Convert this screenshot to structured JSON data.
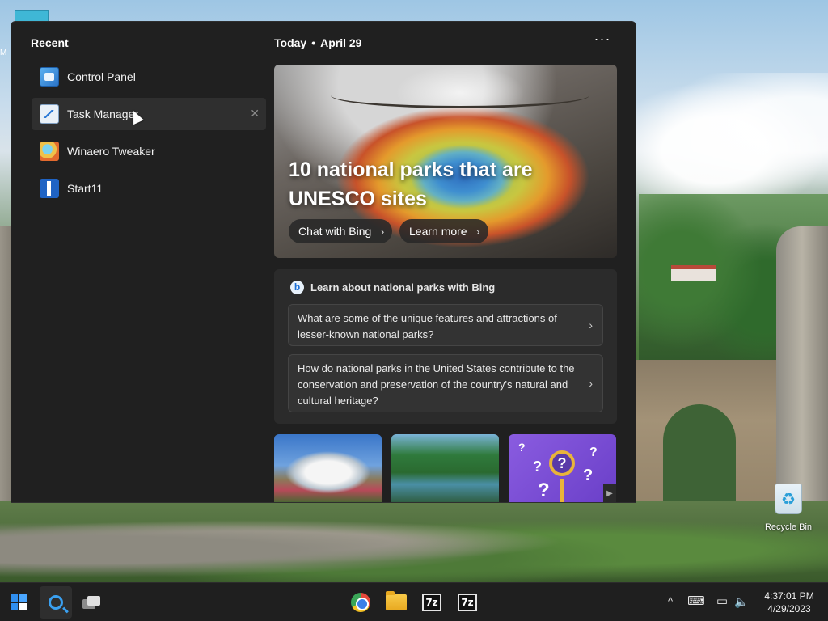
{
  "desktop": {
    "recycle_bin_label": "Recycle Bin",
    "top_icon_label": "M"
  },
  "recent": {
    "title": "Recent",
    "items": [
      {
        "label": "Control Panel",
        "icon": "control-panel-icon"
      },
      {
        "label": "Task Manager",
        "icon": "task-manager-icon"
      },
      {
        "label": "Winaero Tweaker",
        "icon": "winaero-tweaker-icon"
      },
      {
        "label": "Start11",
        "icon": "start11-icon"
      }
    ],
    "remove_glyph": "✕"
  },
  "today": {
    "label": "Today",
    "separator": "•",
    "date": "April 29",
    "more_glyph": "···"
  },
  "hero": {
    "title": "10 national parks that are UNESCO sites",
    "chat_button": "Chat with Bing",
    "learn_button": "Learn more",
    "chevron": "›"
  },
  "bing": {
    "logo": "b",
    "title": "Learn about national parks with Bing",
    "questions": [
      "What are some of the unique features and attractions of lesser-known national parks?",
      "How do national parks in the United States contribute to the conservation and preservation of the country's natural and cultural heritage?"
    ],
    "chevron": "›"
  },
  "thumbnails": [
    {
      "name": "mountain-meadow-thumbnail"
    },
    {
      "name": "forest-lake-thumbnail"
    },
    {
      "name": "quiz-thumbnail"
    }
  ],
  "taskbar": {
    "apps": [
      {
        "name": "start-button",
        "icon": "windows-logo-icon"
      },
      {
        "name": "search-button",
        "icon": "search-icon"
      },
      {
        "name": "task-view-button",
        "icon": "task-view-icon"
      },
      {
        "name": "chrome-button",
        "icon": "chrome-icon"
      },
      {
        "name": "file-explorer-button",
        "icon": "folder-icon"
      },
      {
        "name": "7zip-button-1",
        "icon": "7zip-icon",
        "text": "7z"
      },
      {
        "name": "7zip-button-2",
        "icon": "7zip-icon",
        "text": "7z"
      }
    ],
    "tray": {
      "chevron": "^",
      "keyboard": "⌨",
      "network": "▭",
      "volume": "🔈"
    },
    "clock": {
      "time": "4:37:01 PM",
      "date": "4/29/2023"
    }
  },
  "colors": {
    "panel_bg": "#202020",
    "card_bg": "#2b2b2b",
    "accent": "#3aa0f0"
  }
}
